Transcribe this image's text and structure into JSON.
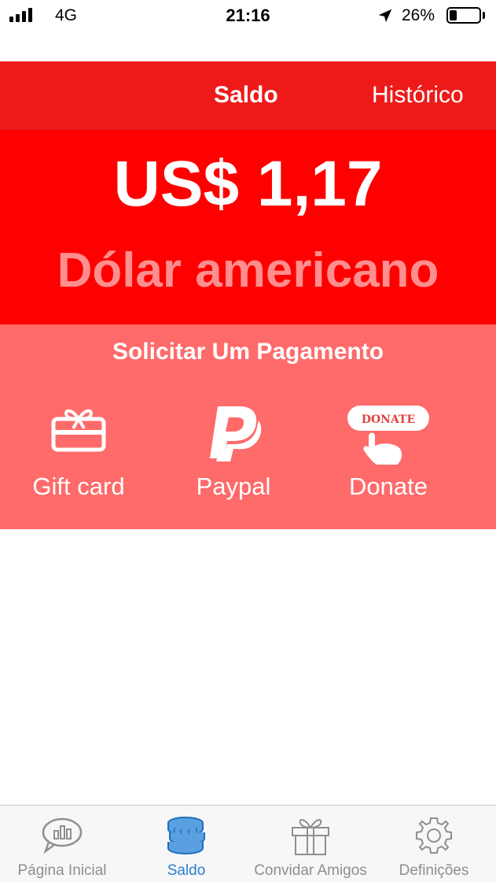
{
  "status_bar": {
    "network": "4G",
    "time": "21:16",
    "battery_percent": "26%",
    "battery_level": 0.26,
    "icons": [
      "signal-icon",
      "location-arrow-icon",
      "battery-icon"
    ]
  },
  "top_tabs": {
    "balance_label": "Saldo",
    "history_label": "Histórico",
    "active": "Saldo"
  },
  "balance": {
    "amount": "US$ 1,17",
    "currency_name": "Dólar americano"
  },
  "payment": {
    "title": "Solicitar Um Pagamento",
    "options": [
      {
        "label": "Gift card",
        "icon": "gift-card-icon"
      },
      {
        "label": "Paypal",
        "icon": "paypal-icon"
      },
      {
        "label": "Donate",
        "icon": "donate-icon",
        "icon_text": "DONATE"
      }
    ]
  },
  "bottom_nav": {
    "items": [
      {
        "label": "Página Inicial",
        "icon": "chart-bubble-icon"
      },
      {
        "label": "Saldo",
        "icon": "coins-icon",
        "active": true
      },
      {
        "label": "Convidar Amigos",
        "icon": "gift-icon"
      },
      {
        "label": "Definições",
        "icon": "gear-icon"
      }
    ]
  },
  "colors": {
    "tab_bar": "#ee1a1a",
    "balance_bg": "#fe0000",
    "currency_text": "#ff8e8e",
    "payment_bg": "#ff6a6a",
    "nav_active": "#2a7fd0",
    "nav_inactive": "#8e8e93"
  }
}
